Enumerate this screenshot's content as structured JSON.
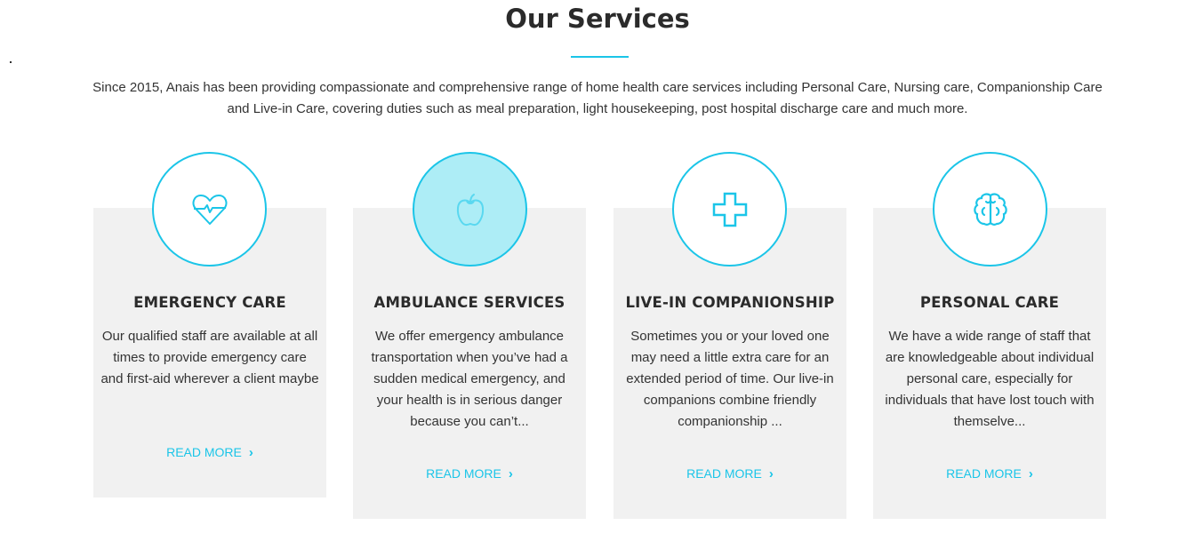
{
  "header": {
    "title": "Our Services",
    "intro": "Since 2015, Anais has been providing compassionate and comprehensive range of home health care services including Personal Care, Nursing care, Companionship Care and Live-in Care, covering duties such as meal preparation, light housekeeping, post hospital discharge care and much more."
  },
  "accent_color": "#1bc5e8",
  "services": [
    {
      "icon": "heart-pulse-icon",
      "title": "EMERGENCY CARE",
      "text": "Our qualified staff are available at all times to provide emergency care and first-aid wherever a client maybe",
      "link": "READ MORE"
    },
    {
      "icon": "apple-icon",
      "title": "AMBULANCE SERVICES",
      "text": "We offer emergency ambulance transportation when you’ve had a sudden medical emergency, and your health is in serious danger because you can’t...",
      "link": "READ MORE"
    },
    {
      "icon": "medical-cross-icon",
      "title": "LIVE-IN COMPANIONSHIP",
      "text": "Sometimes you or your loved one may need a little extra care for an extended period of time. Our live-in companions combine friendly companionship ...",
      "link": "READ MORE"
    },
    {
      "icon": "brain-icon",
      "title": "PERSONAL CARE",
      "text": "We have a wide range of staff that are knowledgeable about individual personal care, especially for individuals that have lost touch with themselve...",
      "link": "READ MORE"
    }
  ]
}
